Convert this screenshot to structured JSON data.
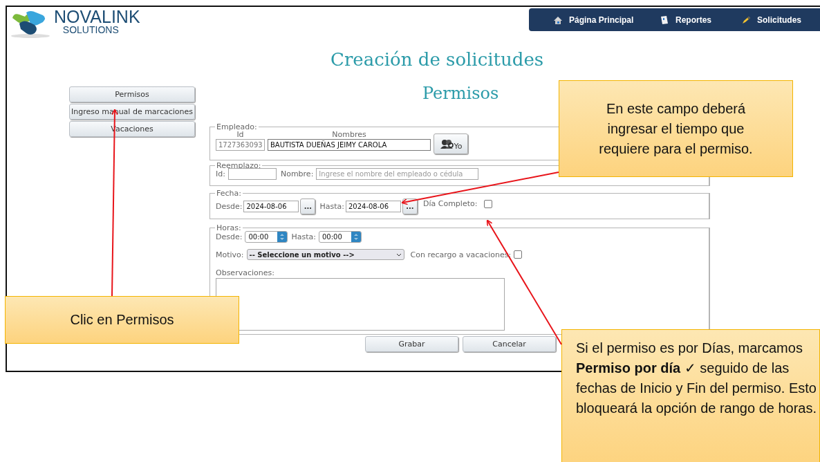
{
  "logo": {
    "name": "NOVALINK",
    "subtitle": "SOLUTIONS"
  },
  "nav": [
    {
      "kind": "home",
      "label": "Página Principal"
    },
    {
      "kind": "report",
      "label": "Reportes"
    },
    {
      "kind": "request",
      "label": "Solicitudes"
    }
  ],
  "page_title": "Creación de solicitudes",
  "section_title": "Permisos",
  "sidebar": [
    {
      "label": "Permisos"
    },
    {
      "label": "Ingreso manual de marcaciones"
    },
    {
      "label": "Vacaciones"
    }
  ],
  "employee": {
    "legend": "Empleado:",
    "id_label": "Id",
    "name_label": "Nombres",
    "id": "1727363093",
    "name": "BAUTISTA DUEÑAS JEIMY CAROLA",
    "me_button": "Yo"
  },
  "replacement": {
    "legend": "Reemplazo:",
    "id_label": "Id:",
    "name_label": "Nombre:",
    "name_placeholder": "Ingrese el nombre del empleado o cédula"
  },
  "date": {
    "legend": "Fecha:",
    "from_label": "Desde:",
    "from": "2024-08-06",
    "from_picker": "...",
    "to_label": "Hasta:",
    "to": "2024-08-06",
    "to_picker": "...",
    "full_day_label": "Día Completo:",
    "full_day_checked": false
  },
  "hours": {
    "legend": "Horas:",
    "from_label": "Desde:",
    "from": "00:00",
    "to_label": "Hasta:",
    "to": "00:00",
    "reason_label": "Motivo:",
    "reason": "-- Seleccione un motivo -->",
    "surcharge_label": "Con recargo a vacaciones:",
    "surcharge_checked": false,
    "notes_label": "Observaciones:"
  },
  "actions": [
    "Grabar",
    "Cancelar"
  ],
  "callouts": [
    {
      "text": "En este campo deberá ingresar el tiempo que requiere para el permiso."
    },
    {
      "text": "Clic en Permisos"
    },
    {
      "text": "Si el permiso es por Días, marcamos **Permiso por día** ✓ seguido de las fechas de Inicio y Fin del permiso. Esto bloqueará la opción de rango de horas."
    }
  ]
}
